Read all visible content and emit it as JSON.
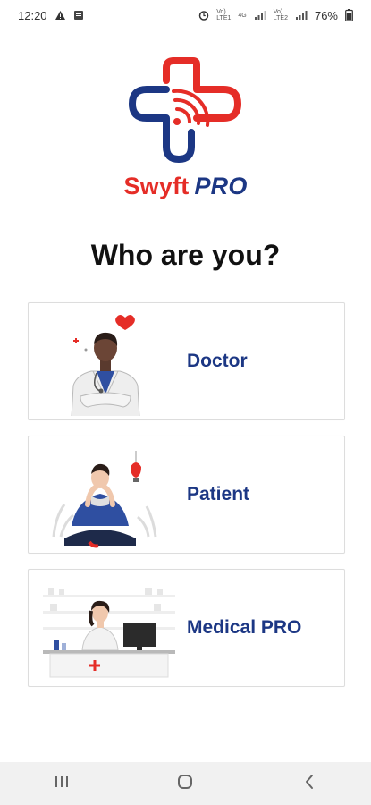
{
  "status_bar": {
    "time": "12:20",
    "battery": "76%",
    "icons": [
      "warning-icon",
      "notification-square-icon",
      "alarm-icon",
      "volte-lte1-icon",
      "signal1-icon",
      "volte-lte2-icon",
      "signal2-icon",
      "battery-icon"
    ],
    "net1_top": "Vo)",
    "net1_bottom": "LTE1",
    "net2_top": "4G",
    "net3_top": "Vo)",
    "net3_bottom": "LTE2"
  },
  "brand": {
    "name_part1": "Swyft",
    "name_part2": "PRO",
    "logo_colors": {
      "red": "#e52d27",
      "navy": "#1c3784"
    }
  },
  "heading": "Who are you?",
  "roles": [
    {
      "label": "Doctor",
      "illustration": "doctor-illustration"
    },
    {
      "label": "Patient",
      "illustration": "patient-illustration"
    },
    {
      "label": "Medical PRO",
      "illustration": "pharmacist-illustration"
    }
  ],
  "nav": {
    "buttons": [
      "recent-apps-icon",
      "home-icon",
      "back-icon"
    ]
  },
  "colors": {
    "label": "#1c3784",
    "accent_red": "#e52d27",
    "patient_blue": "#2f4fa1"
  }
}
